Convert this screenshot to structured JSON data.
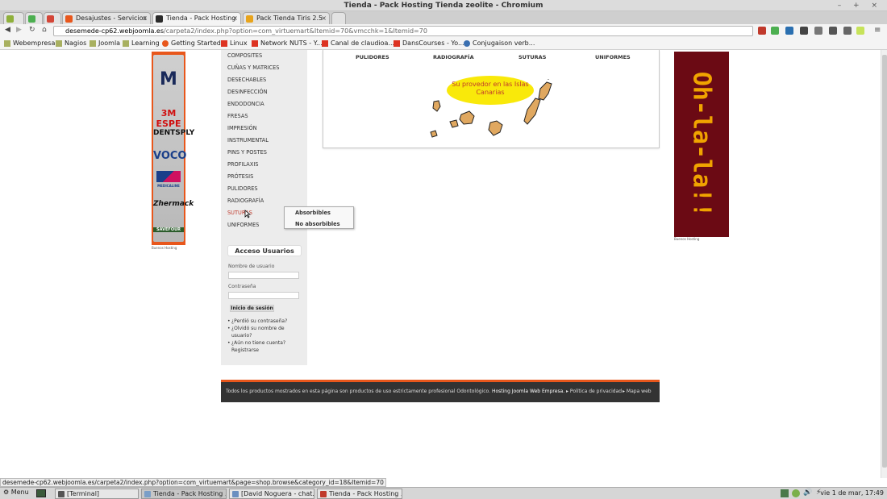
{
  "window": {
    "title": "Tienda - Pack Hosting Tienda zeolite - Chromium",
    "controls": "– + ×"
  },
  "tabs": [
    {
      "label": "",
      "color": "#8fb03b"
    },
    {
      "label": "",
      "color": "#4caf50"
    },
    {
      "label": "",
      "color": "#d44638"
    },
    {
      "label": "Desajustes - Servicios",
      "color": "#e8571c"
    },
    {
      "label": "Tienda - Pack Hosting",
      "color": "#2b2b2b"
    },
    {
      "label": "Pack Tienda Tiris 2.5",
      "color": "#e8a41c"
    }
  ],
  "toolbar": {
    "url_host": "desemede-cp62.webjoomla.es",
    "url_path": "/carpeta2/index.php?option=com_virtuemart&Itemid=70&vmcchk=1&Itemid=70",
    "back": "◀",
    "forward": "▶",
    "reload": "↻",
    "home": "⌂",
    "menu": "≡"
  },
  "bookmarks": [
    "Webempresa",
    "Nagios",
    "Joomla",
    "Learning",
    "Getting Started",
    "Linux",
    "Network NUTS - Y...",
    "Canal de claudioa...",
    "DansCourses - Yo...",
    "Conjugaison verb..."
  ],
  "left_banner": {
    "brands": [
      "M",
      "3M ESPE",
      "DENTSPLY",
      "VOCO",
      "MEDICALINE",
      "Zhermack",
      "SAVEFOUR"
    ],
    "caption": "Buenos Hosting"
  },
  "categories_menu": [
    "COMPOSITES",
    "CUÑAS Y MATRICES",
    "DESECHABLES",
    "DESINFECCIÓN",
    "ENDODONCIA",
    "FRESAS",
    "IMPRESIÓN",
    "INSTRUMENTAL",
    "PINS Y POSTES",
    "PROFILAXIS",
    "PRÓTESIS",
    "PULIDORES",
    "RADIOGRAFÍA",
    "SUTURAS",
    "UNIFORMES"
  ],
  "submenu": [
    "Absorbibles",
    "No absorbibles"
  ],
  "top_categories": [
    "PULIDORES",
    "RADIOGRAFÍA",
    "SUTURAS",
    "UNIFORMES"
  ],
  "promo": "Su provedor en las Islas Canarias",
  "right_banner": {
    "text": "Oh-la-la!!",
    "caption": "Buenos Hosting"
  },
  "login": {
    "title": "Acceso Usuarios",
    "username_label": "Nombre de usuario",
    "password_label": "Contraseña",
    "button": "Inicio de sesión",
    "links": [
      "¿Perdió su contraseña?",
      "¿Olvidó su nombre de usuario?",
      "¿Aún no tiene cuenta? Registrarse"
    ]
  },
  "footer": {
    "text": "Todos los productos mostrados en esta página son productos de uso estrictamente profesional Odontológico.",
    "link": "Hosting Joomla Web Empresa.",
    "privacy": "Política de privacidad",
    "sitemap": "Mapa web"
  },
  "status_url": "desemede-cp62.webjoomla.es/carpeta2/index.php?option=com_virtuemart&page=shop.browse&category_id=18&Itemid=70",
  "taskbar": {
    "menu": "Menu",
    "tasks": [
      "[Terminal]",
      "Tienda - Pack Hosting ...",
      "[David Noguera - chat...",
      "Tienda - Pack Hosting ..."
    ],
    "clock": "vie 1 de mar, 17:49"
  },
  "colors": {
    "accent": "#e8571c",
    "menu_highlight": "#c0392b",
    "banner": "#6b0a14",
    "promo": "#f9e90a"
  }
}
